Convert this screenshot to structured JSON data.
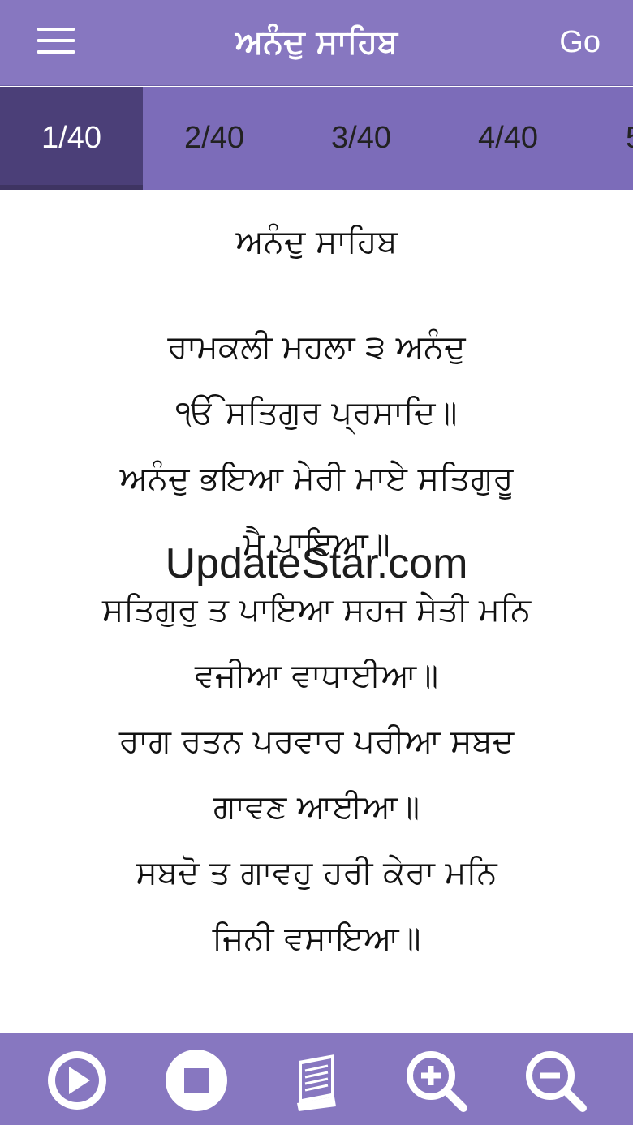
{
  "header": {
    "title": "ਅਨੰਦੁ ਸਾਹਿਬ",
    "go_label": "Go"
  },
  "tabs": [
    {
      "label": "1/40",
      "active": true
    },
    {
      "label": "2/40"
    },
    {
      "label": "3/40"
    },
    {
      "label": "4/40"
    },
    {
      "label": "5"
    }
  ],
  "content": {
    "heading": "ਅਨੰਦੁ ਸਾਹਿਬ",
    "lines": [
      "ਰਾਮਕਲੀ ਮਹਲਾ ੩ ਅਨੰਦੁ",
      "ੴ ਸਤਿਗੁਰ ਪ੍ਰਸਾਦਿ॥",
      "ਅਨੰਦੁ ਭਇਆ ਮੇਰੀ ਮਾਏ ਸਤਿਗੁਰੂ",
      "ਮੈ ਪਾਇਆ॥",
      "ਸਤਿਗੁਰੁ ਤ ਪਾਇਆ ਸਹਜ ਸੇਤੀ ਮਨਿ",
      "ਵਜੀਆ ਵਾਧਾਈਆ॥",
      "ਰਾਗ ਰਤਨ ਪਰਵਾਰ ਪਰੀਆ ਸਬਦ",
      "ਗਾਵਣ ਆਈਆ॥",
      "ਸਬਦੋ ਤ ਗਾਵਹੁ ਹਰੀ ਕੇਰਾ ਮਨਿ",
      "ਜਿਨੀ ਵਸਾਇਆ॥"
    ]
  },
  "watermark": "UpdateStar.com",
  "toolbar": {
    "icons": [
      "play-icon",
      "stop-icon",
      "book-icon",
      "zoom-in-icon",
      "zoom-out-icon"
    ]
  },
  "colors": {
    "header_bg": "#8777c0",
    "tabs_bg": "#7c6cb9",
    "active_tab_bg": "#4b3f78",
    "toolbar_bg": "#8777c0"
  }
}
